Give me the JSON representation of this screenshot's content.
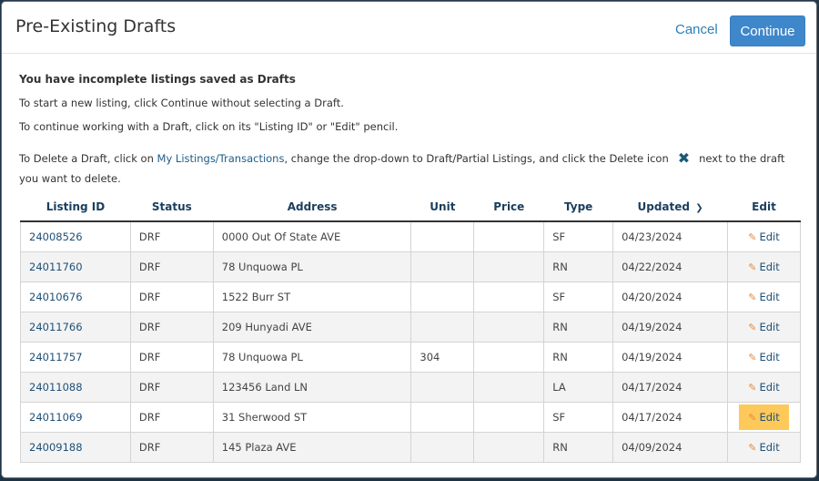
{
  "dialog": {
    "title": "Pre-Existing Drafts",
    "cancel_label": "Cancel",
    "continue_label": "Continue"
  },
  "intro": {
    "heading": "You have incomplete listings saved as Drafts",
    "line1": "To start a new listing, click Continue without selecting a Draft.",
    "line2": "To continue working with a Draft, click on its \"Listing ID\" or \"Edit\" pencil.",
    "line3_pre": "To Delete a Draft, click on ",
    "line3_link": "My Listings/Transactions",
    "line3_mid": ", change the drop-down to Draft/Partial Listings, and click the Delete icon",
    "line3_icon": "✖",
    "line3_post": "next to the draft you want to delete."
  },
  "table": {
    "columns": [
      "Listing ID",
      "Status",
      "Address",
      "Unit",
      "Price",
      "Type",
      "Updated",
      "Edit"
    ],
    "sort_icon": "chevron-down-icon",
    "edit_label": "Edit",
    "rows": [
      {
        "id": "24008526",
        "status": "DRF",
        "address": "0000 Out Of State AVE",
        "unit": "",
        "price": "",
        "type": "SF",
        "updated": "04/23/2024"
      },
      {
        "id": "24011760",
        "status": "DRF",
        "address": "78 Unquowa PL",
        "unit": "",
        "price": "",
        "type": "RN",
        "updated": "04/22/2024"
      },
      {
        "id": "24010676",
        "status": "DRF",
        "address": "1522 Burr ST",
        "unit": "",
        "price": "",
        "type": "SF",
        "updated": "04/20/2024"
      },
      {
        "id": "24011766",
        "status": "DRF",
        "address": "209 Hunyadi AVE",
        "unit": "",
        "price": "",
        "type": "RN",
        "updated": "04/19/2024"
      },
      {
        "id": "24011757",
        "status": "DRF",
        "address": "78 Unquowa PL",
        "unit": "304",
        "price": "",
        "type": "RN",
        "updated": "04/19/2024"
      },
      {
        "id": "24011088",
        "status": "DRF",
        "address": "123456 Land LN",
        "unit": "",
        "price": "",
        "type": "LA",
        "updated": "04/17/2024"
      },
      {
        "id": "24011069",
        "status": "DRF",
        "address": "31 Sherwood ST",
        "unit": "",
        "price": "",
        "type": "SF",
        "updated": "04/17/2024",
        "hovered": true
      },
      {
        "id": "24009188",
        "status": "DRF",
        "address": "145 Plaza AVE",
        "unit": "",
        "price": "",
        "type": "RN",
        "updated": "04/09/2024"
      }
    ]
  },
  "colors": {
    "primary_button": "#3f87cb",
    "link": "#1e4f76",
    "pencil": "#e8893a",
    "hover_highlight": "#fdc95b"
  }
}
